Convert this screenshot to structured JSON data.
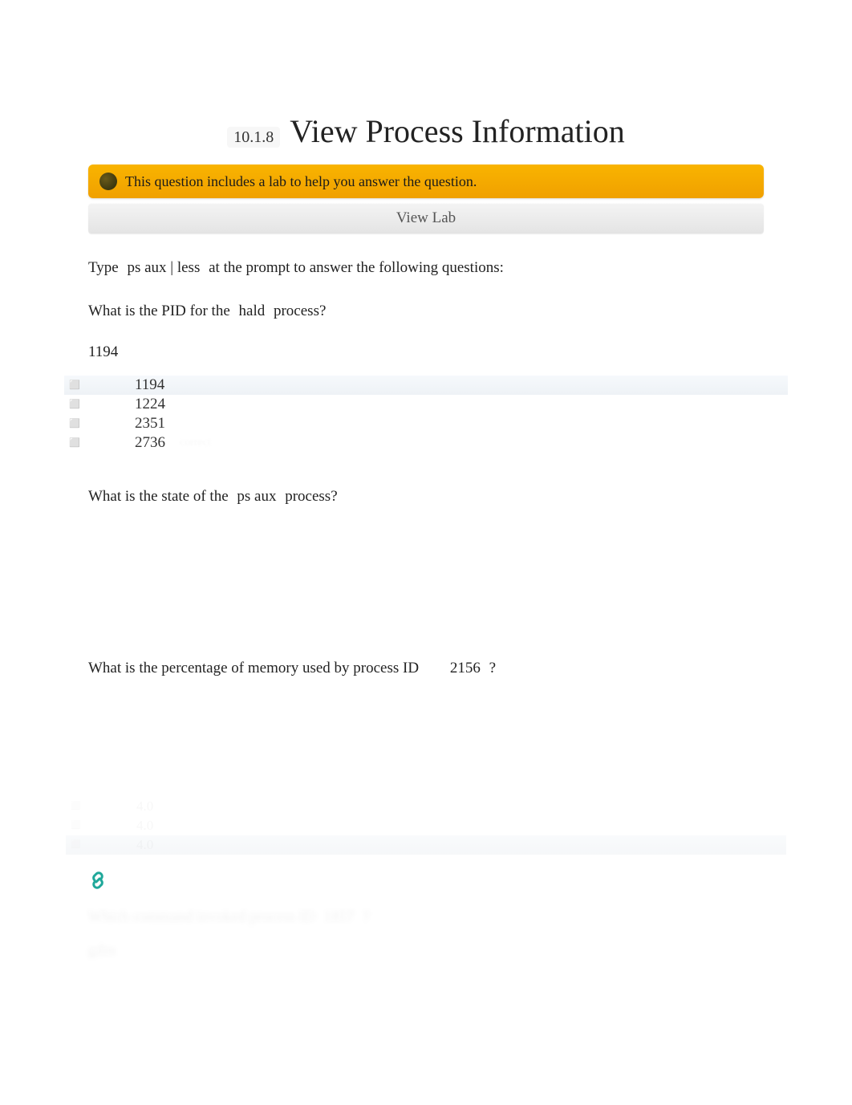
{
  "header": {
    "section_number": "10.1.8",
    "title": "View Process Information"
  },
  "alert": {
    "text": "This question includes a lab to help you answer the question."
  },
  "view_lab": {
    "label": "View Lab"
  },
  "intro": {
    "prefix": "Type",
    "command": "ps aux | less",
    "suffix": "at the prompt to answer the following questions:"
  },
  "q1": {
    "prefix": "What is the PID for the",
    "code": "hald",
    "suffix": "process?",
    "answer": "1194",
    "options": [
      "1194",
      "1224",
      "2351",
      "2736"
    ],
    "selected_index": 0,
    "extra_hint": "correct"
  },
  "q2": {
    "prefix": "What is the state of the",
    "code": "ps aux",
    "suffix": "process?"
  },
  "q3": {
    "prefix": "What is the percentage of memory used by process ID",
    "code": "2156",
    "suffix": "?"
  },
  "q3_faded_options": [
    "4.0",
    "4.0",
    "4.0"
  ],
  "q4_blur": {
    "text_a": "Which command invoked process ID",
    "code": "1857",
    "text_b": "?",
    "answer": "gdm"
  }
}
